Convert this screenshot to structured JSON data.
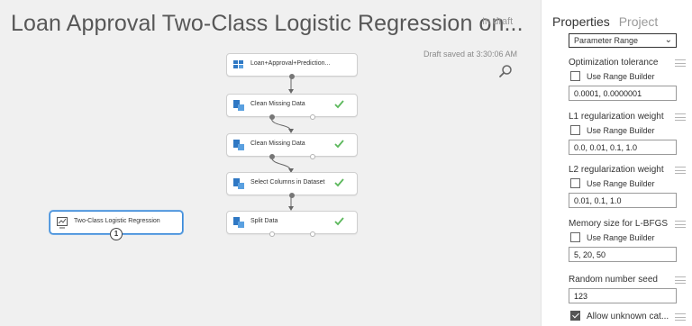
{
  "experiment": {
    "title": "Loan Approval Two-Class Logistic Regression on...",
    "status": "In draft",
    "saved": "Draft saved at 3:30:06 AM"
  },
  "canvas": {
    "modules": [
      {
        "label": "Loan+Approval+Prediction...",
        "icon": "dataset-icon",
        "check": false
      },
      {
        "label": "Clean Missing Data",
        "icon": "module-icon",
        "check": true
      },
      {
        "label": "Clean Missing Data",
        "icon": "module-icon",
        "check": true
      },
      {
        "label": "Select Columns in Dataset",
        "icon": "module-icon",
        "check": true
      },
      {
        "label": "Split Data",
        "icon": "module-icon",
        "check": true
      },
      {
        "label": "Two-Class Logistic Regression",
        "icon": "model-icon",
        "check": false,
        "badge": "1"
      }
    ]
  },
  "panel": {
    "tabs": [
      "Properties",
      "Project"
    ],
    "mode": "Parameter Range",
    "range_builder_label": "Use Range Builder",
    "params": [
      {
        "label": "Optimization tolerance",
        "value": "0.0001, 0.0000001"
      },
      {
        "label": "L1 regularization weight",
        "value": "0.0, 0.01, 0.1, 1.0"
      },
      {
        "label": "L2 regularization weight",
        "value": "0.01, 0.1, 1.0"
      },
      {
        "label": "Memory size for L-BFGS",
        "value": "5, 20, 50"
      }
    ],
    "seed": {
      "label": "Random number seed",
      "value": "123"
    },
    "allow_unknown": {
      "label": "Allow unknown cat...",
      "checked": true
    }
  },
  "colors": {
    "canvas": "#f0f0f0",
    "selected": "#3b8ad8",
    "check": "#5cb85c"
  }
}
